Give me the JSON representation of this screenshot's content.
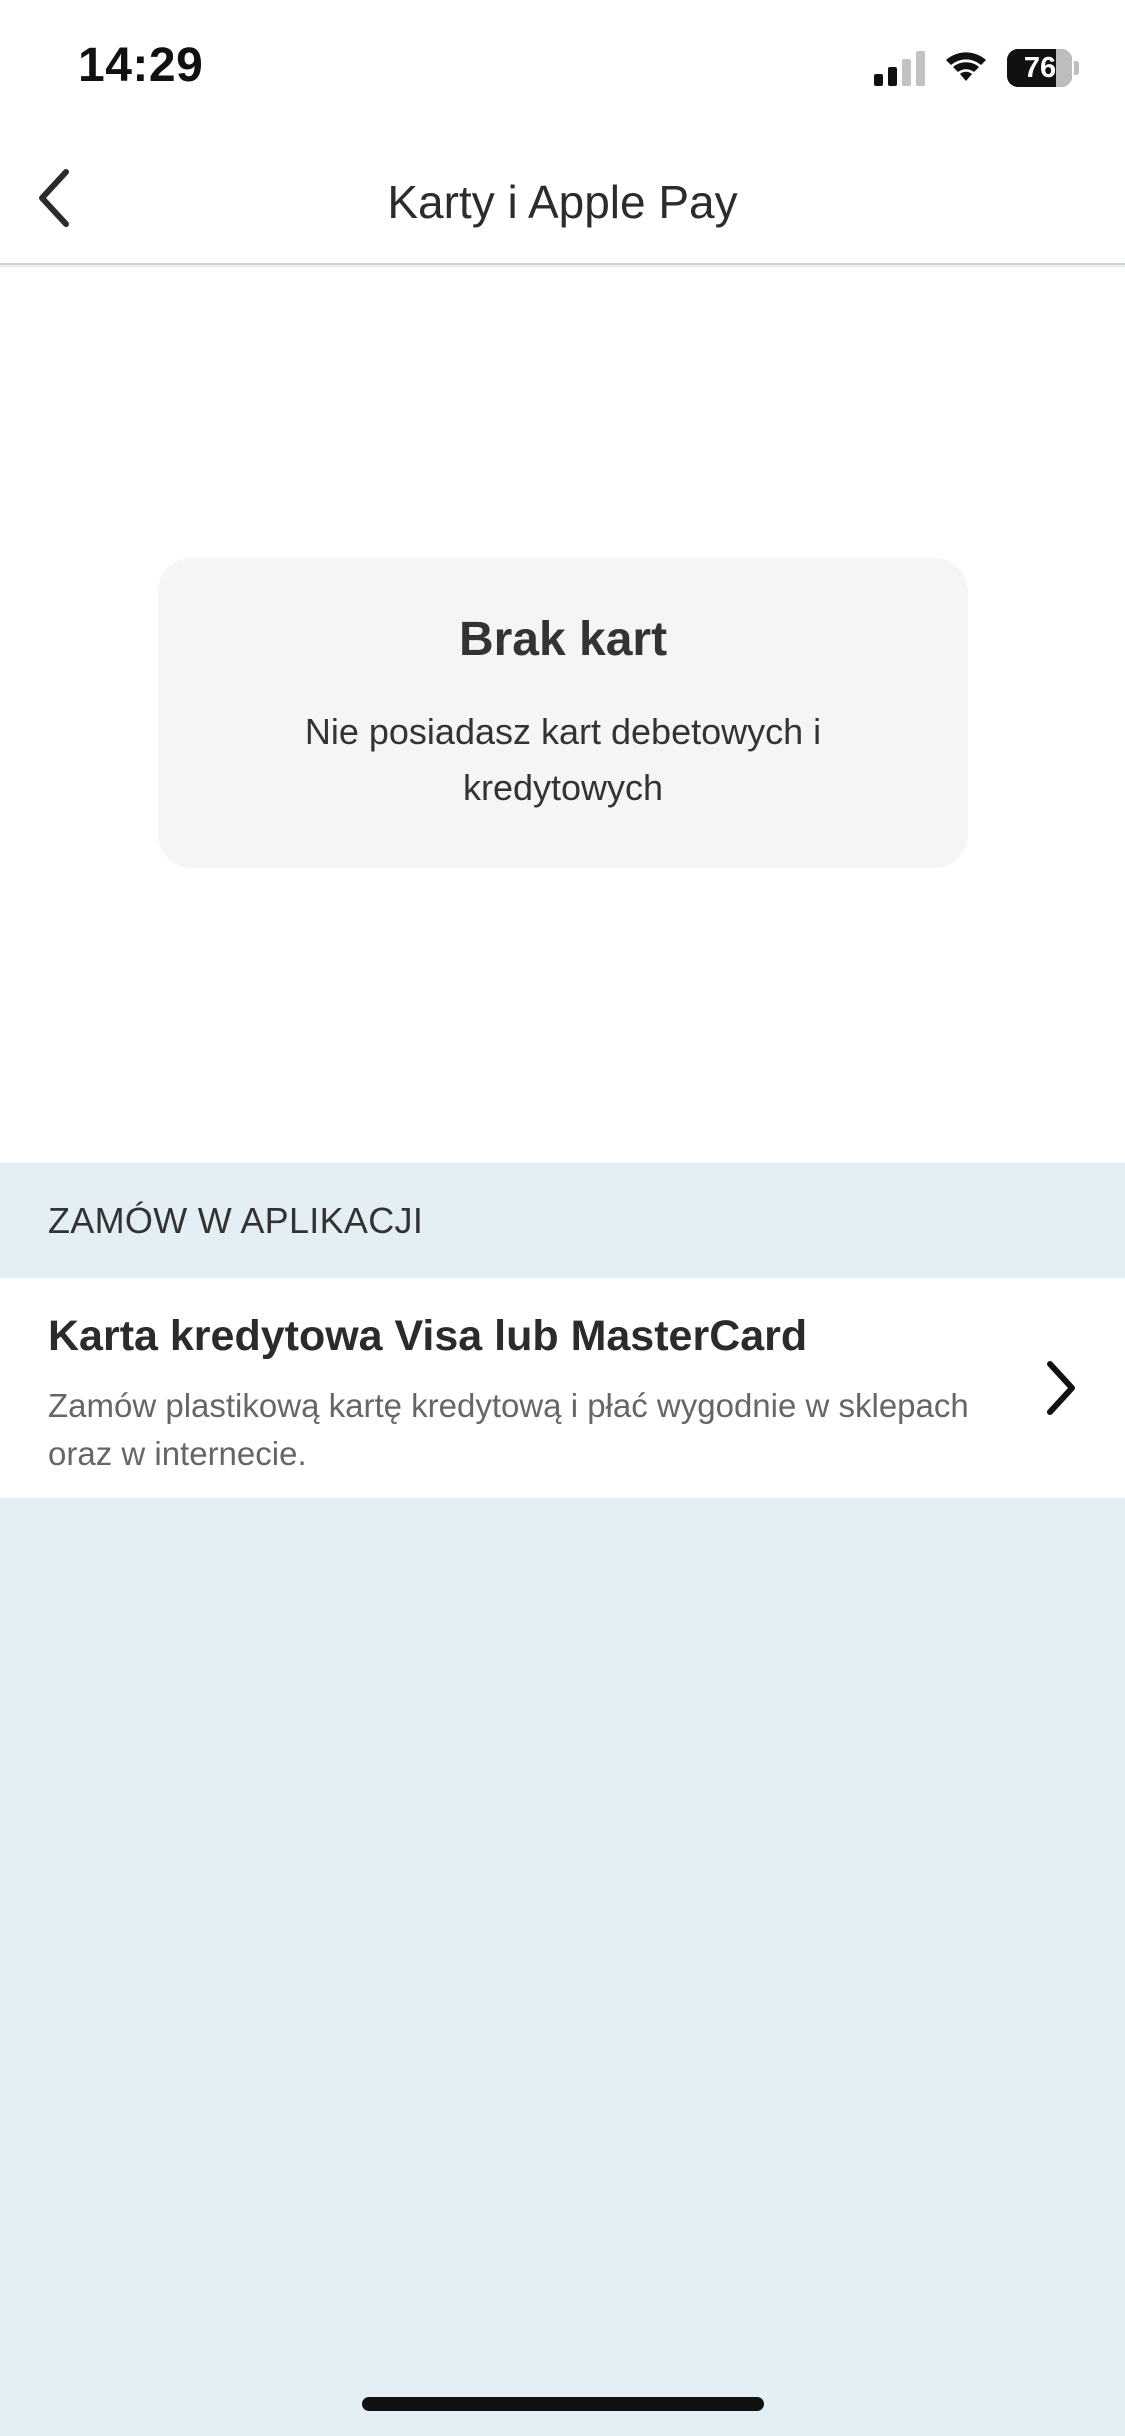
{
  "status_bar": {
    "time": "14:29",
    "battery_level": "76",
    "battery_fraction": 0.76,
    "signal_bars_active": 2,
    "signal_bars_total": 4,
    "icons": [
      "cellular-signal-icon",
      "wifi-icon",
      "battery-icon"
    ]
  },
  "nav": {
    "back_icon": "chevron-left-icon",
    "title": "Karty i Apple Pay"
  },
  "empty_state": {
    "title": "Brak kart",
    "text": "Nie posiadasz kart debetowych i kredytowych"
  },
  "order_section": {
    "header": "ZAMÓW W APLIKACJI",
    "items": [
      {
        "title": "Karta kredytowa Visa lub MasterCard",
        "description": "Zamów plastikową kartę kredytową i płać wygodnie w sklepach oraz w internecie.",
        "icon": "chevron-right-icon"
      }
    ]
  },
  "colors": {
    "page_background": "#e3eff4",
    "surface": "#ffffff",
    "card_background": "#f4f6f6",
    "text_primary": "#2b2b2b",
    "text_secondary": "#666666"
  }
}
